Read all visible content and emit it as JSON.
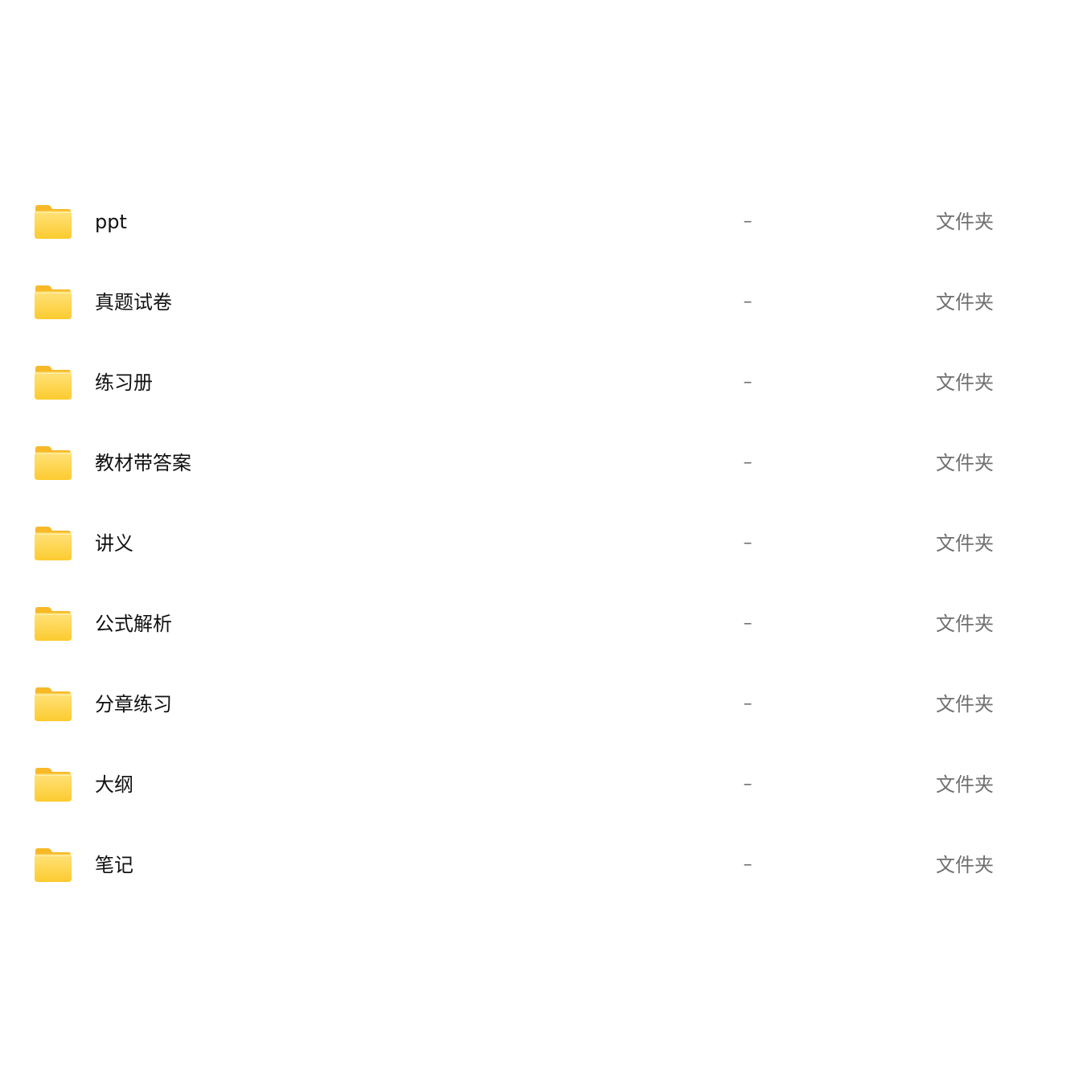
{
  "files": [
    {
      "name": "ppt",
      "size": "–",
      "kind": "文件夹",
      "icon": "folder-icon"
    },
    {
      "name": "真题试卷",
      "size": "–",
      "kind": "文件夹",
      "icon": "folder-icon"
    },
    {
      "name": "练习册",
      "size": "–",
      "kind": "文件夹",
      "icon": "folder-icon"
    },
    {
      "name": "教材带答案",
      "size": "–",
      "kind": "文件夹",
      "icon": "folder-icon"
    },
    {
      "name": "讲义",
      "size": "–",
      "kind": "文件夹",
      "icon": "folder-icon"
    },
    {
      "name": "公式解析",
      "size": "–",
      "kind": "文件夹",
      "icon": "folder-icon"
    },
    {
      "name": "分章练习",
      "size": "–",
      "kind": "文件夹",
      "icon": "folder-icon"
    },
    {
      "name": "大纲",
      "size": "–",
      "kind": "文件夹",
      "icon": "folder-icon"
    },
    {
      "name": "笔记",
      "size": "–",
      "kind": "文件夹",
      "icon": "folder-icon"
    }
  ],
  "colors": {
    "folder_back": "#F7B928",
    "folder_front_top": "#FFE27A",
    "folder_front_bottom": "#FCCB2F",
    "name_text": "#111111",
    "meta_text": "#707070"
  }
}
